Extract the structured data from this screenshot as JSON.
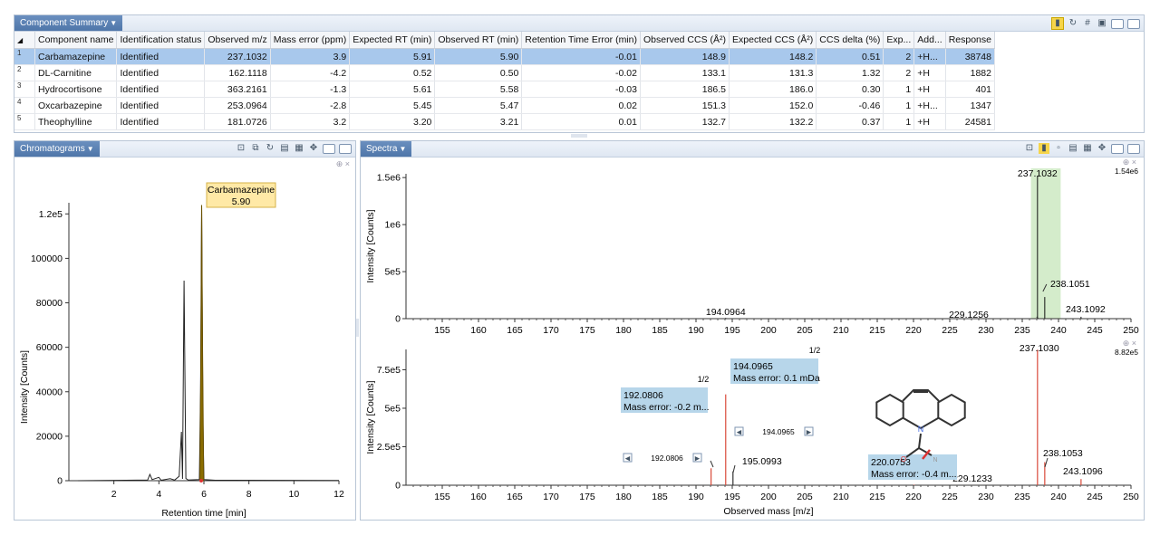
{
  "summary": {
    "title": "Component Summary",
    "columns": [
      "Component name",
      "Identification status",
      "Observed m/z",
      "Mass error (ppm)",
      "Expected RT (min)",
      "Observed RT (min)",
      "Retention Time Error (min)",
      "Observed CCS (Å²)",
      "Expected CCS (Å²)",
      "CCS delta (%)",
      "Exp...",
      "Add...",
      "Response"
    ],
    "rows": [
      {
        "n": "1",
        "name": "Carbamazepine",
        "status": "Identified",
        "mz": "237.1032",
        "err": "3.9",
        "exprt": "5.91",
        "obsrt": "5.90",
        "rterr": "-0.01",
        "obsccs": "148.9",
        "expccs": "148.2",
        "ccsd": "0.51",
        "exp": "2",
        "add": "+H...",
        "resp": "38748"
      },
      {
        "n": "2",
        "name": "DL-Carnitine",
        "status": "Identified",
        "mz": "162.1118",
        "err": "-4.2",
        "exprt": "0.52",
        "obsrt": "0.50",
        "rterr": "-0.02",
        "obsccs": "133.1",
        "expccs": "131.3",
        "ccsd": "1.32",
        "exp": "2",
        "add": "+H",
        "resp": "1882"
      },
      {
        "n": "3",
        "name": "Hydrocortisone",
        "status": "Identified",
        "mz": "363.2161",
        "err": "-1.3",
        "exprt": "5.61",
        "obsrt": "5.58",
        "rterr": "-0.03",
        "obsccs": "186.5",
        "expccs": "186.0",
        "ccsd": "0.30",
        "exp": "1",
        "add": "+H",
        "resp": "401"
      },
      {
        "n": "4",
        "name": "Oxcarbazepine",
        "status": "Identified",
        "mz": "253.0964",
        "err": "-2.8",
        "exprt": "5.45",
        "obsrt": "5.47",
        "rterr": "0.02",
        "obsccs": "151.3",
        "expccs": "152.0",
        "ccsd": "-0.46",
        "exp": "1",
        "add": "+H...",
        "resp": "1347"
      },
      {
        "n": "5",
        "name": "Theophylline",
        "status": "Identified",
        "mz": "181.0726",
        "err": "3.2",
        "exprt": "3.20",
        "obsrt": "3.21",
        "rterr": "0.01",
        "obsccs": "132.7",
        "expccs": "132.2",
        "ccsd": "0.37",
        "exp": "1",
        "add": "+H",
        "resp": "24581"
      }
    ]
  },
  "chromatogram": {
    "title": "Chromatograms",
    "ylabel": "Intensity [Counts]",
    "xlabel": "Retention time [min]",
    "yticks": [
      "0",
      "20000",
      "40000",
      "60000",
      "80000",
      "100000",
      "1.2e5"
    ],
    "xticks": [
      "2",
      "4",
      "6",
      "8",
      "10",
      "12"
    ],
    "peak_label_name": "Carbamazepine",
    "peak_label_rt": "5.90"
  },
  "spectra": {
    "title": "Spectra",
    "top": {
      "ylabel": "Intensity [Counts]",
      "yticks": [
        "0",
        "5e5",
        "1e6",
        "1.5e6"
      ],
      "scale": "1.54e6",
      "labels": [
        "237.1032",
        "238.1051",
        "243.1092",
        "194.0964",
        "229.1256"
      ]
    },
    "bottom": {
      "ylabel": "Intensity [Counts]",
      "yticks": [
        "0",
        "2.5e5",
        "5e5",
        "7.5e5"
      ],
      "scale": "8.82e5",
      "xlabel": "Observed mass [m/z]",
      "labels": [
        "237.1030",
        "238.1053",
        "243.1096",
        "195.0993",
        "229.1233"
      ],
      "fragment_192": "192.0806",
      "fragment_192_err": "Mass error: -0.2 m...",
      "fragment_194": "194.0965",
      "fragment_194_err": "Mass error: 0.1 mDa",
      "fragment_220": "220.0753",
      "fragment_220_err": "Mass error: -0.4 m...",
      "nav_194": "194.0965",
      "nav_192": "192.0806",
      "page_1": "1/2",
      "page_2": "1/2"
    },
    "xticks": [
      "155",
      "160",
      "165",
      "170",
      "175",
      "180",
      "185",
      "190",
      "195",
      "200",
      "205",
      "210",
      "215",
      "220",
      "225",
      "230",
      "235",
      "240",
      "245",
      "250"
    ]
  },
  "colors": {
    "selection": "#a8c8ec",
    "title_bar": "#4f76a9",
    "peak_fill": "#8a6d00",
    "label_box": "#b7d6ea",
    "highlight": "#cfe8c7",
    "frag": "#d94a3a"
  }
}
